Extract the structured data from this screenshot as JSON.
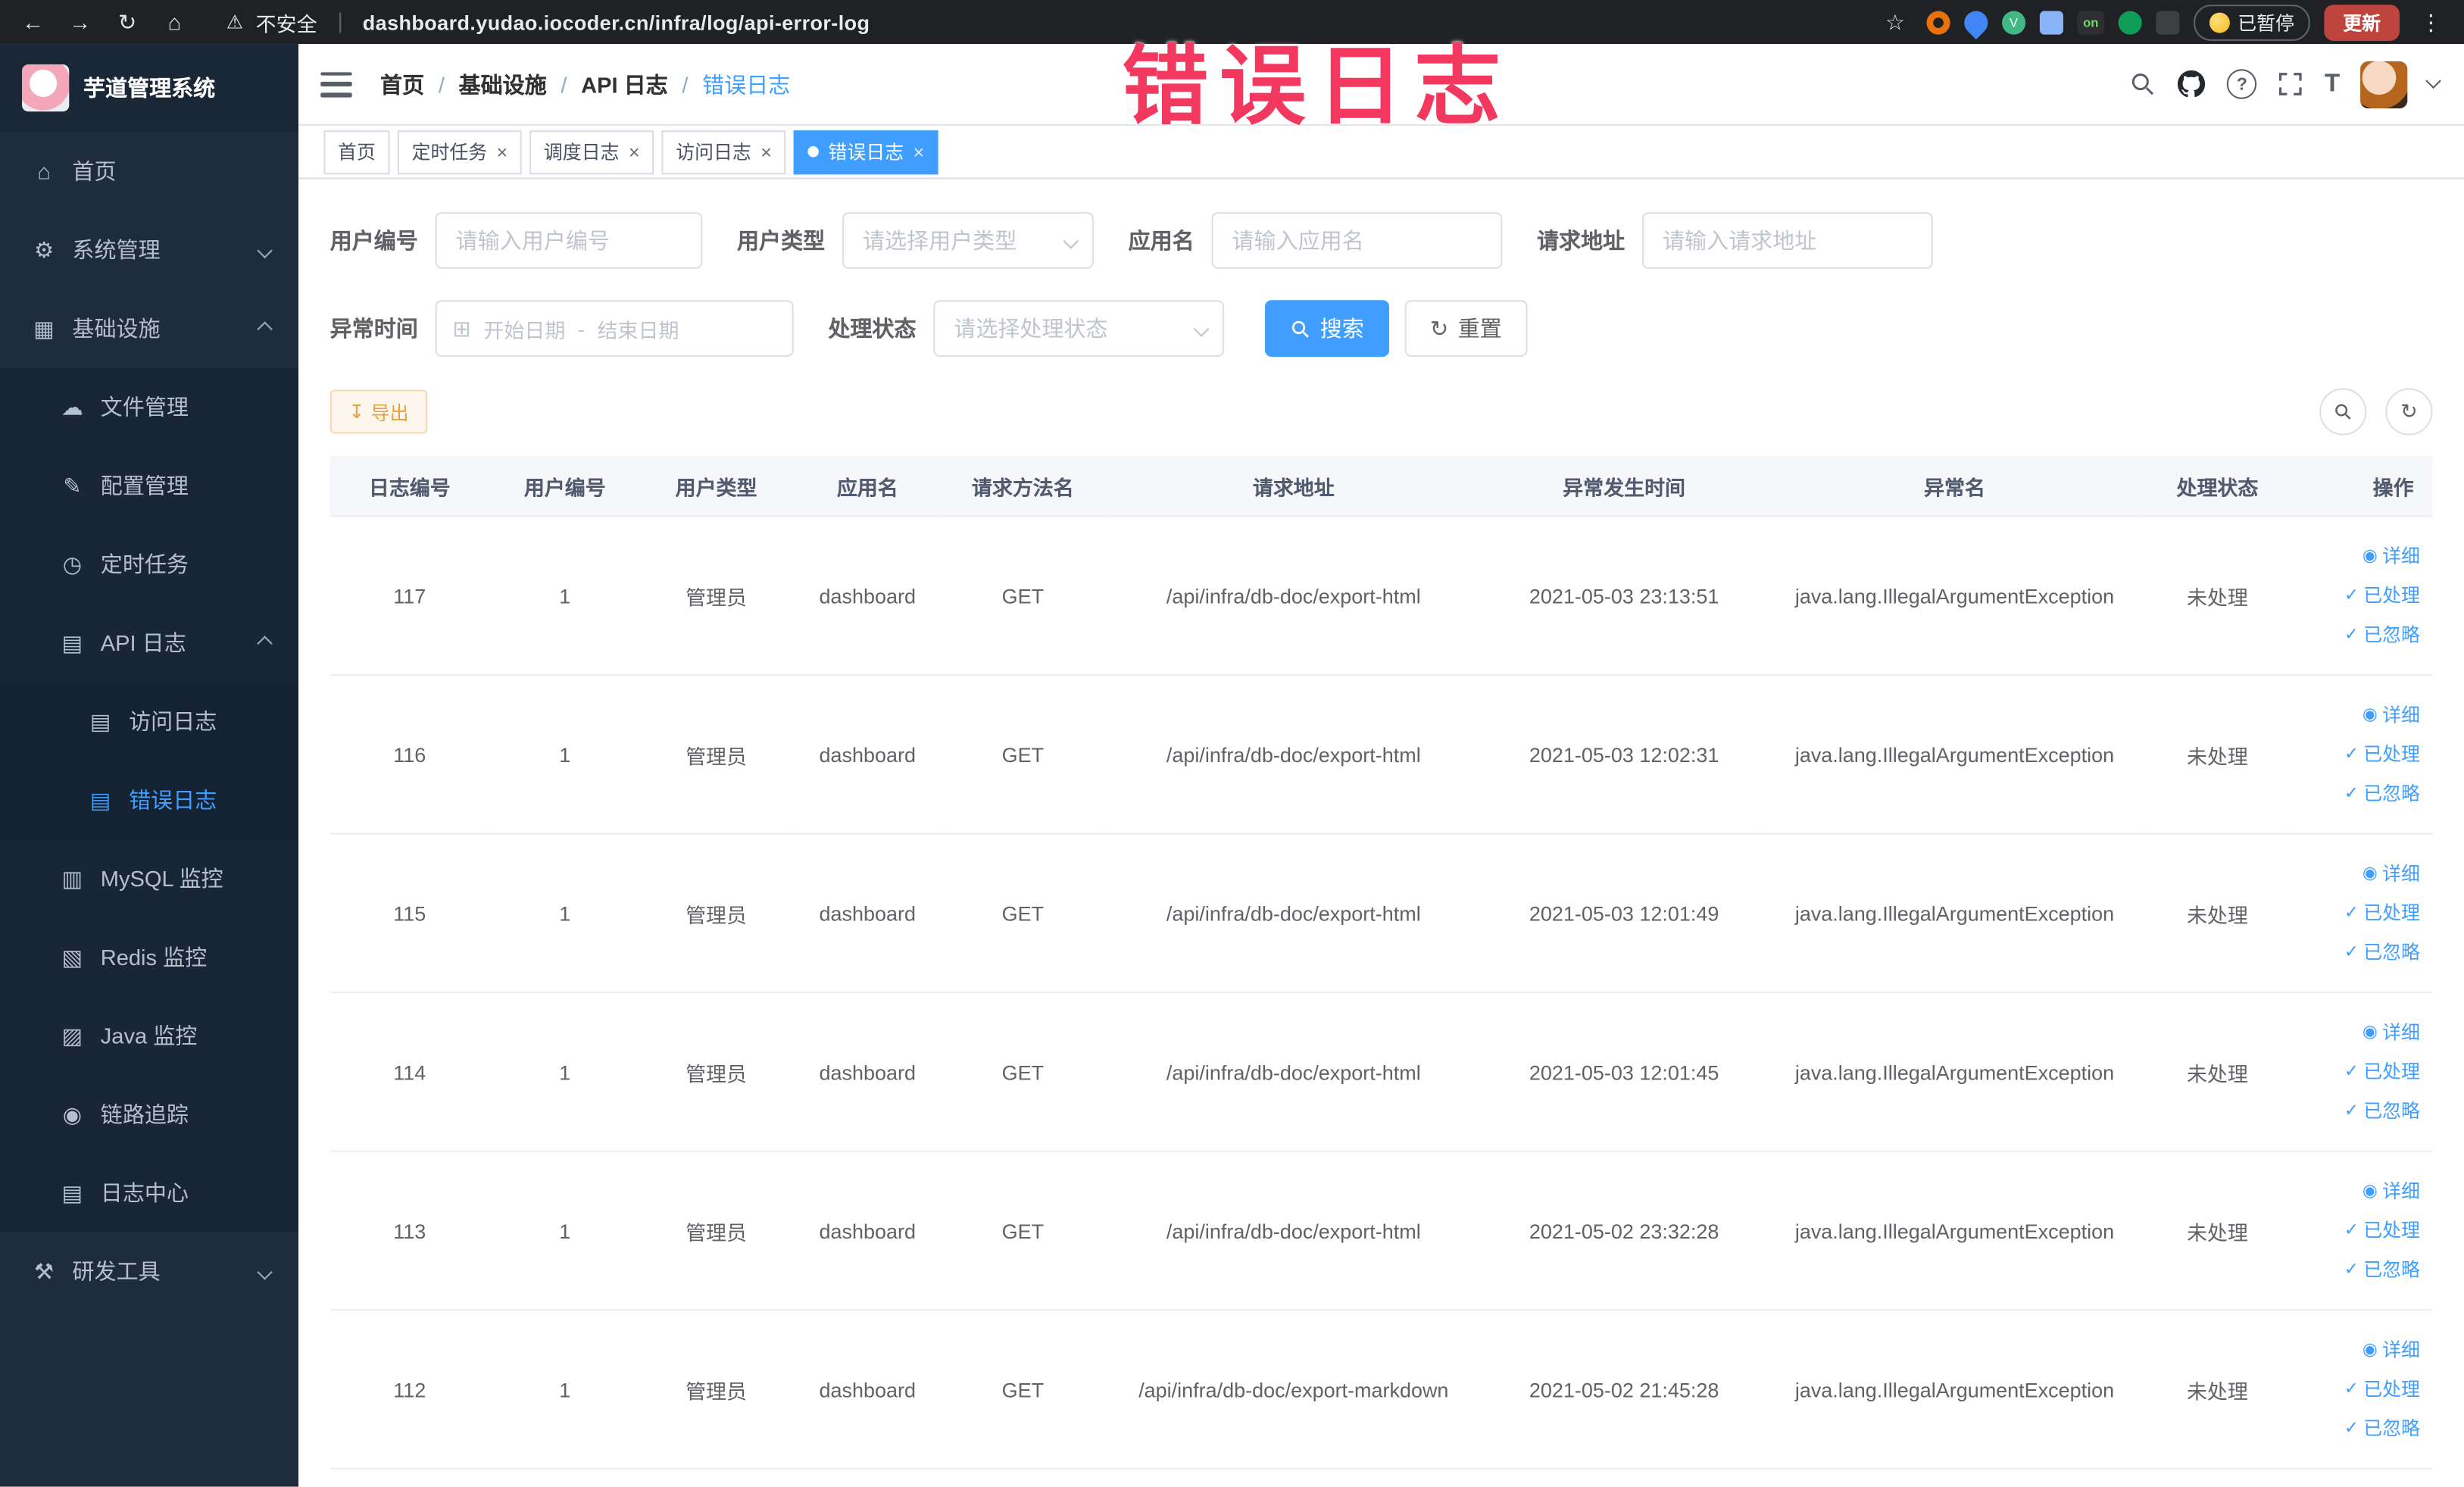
{
  "browser": {
    "security_label": "不安全",
    "url": "dashboard.yudao.iocoder.cn/infra/log/api-error-log",
    "paused_label": "已暂停",
    "update_label": "更新",
    "ext_on_badge": "on"
  },
  "annotation_text": "错误日志",
  "sidebar": {
    "logo_title": "芋道管理系统",
    "menu": [
      {
        "key": "home",
        "label": "首页",
        "icon": "home-icon",
        "level": 0
      },
      {
        "key": "system-mgmt",
        "label": "系统管理",
        "icon": "gear-icon",
        "level": 0,
        "chevron": "down"
      },
      {
        "key": "infrastructure",
        "label": "基础设施",
        "icon": "infra-icon",
        "level": 0,
        "chevron": "up"
      },
      {
        "key": "file-mgmt",
        "label": "文件管理",
        "icon": "file-icon",
        "level": 1
      },
      {
        "key": "config-mgmt",
        "label": "配置管理",
        "icon": "config-icon",
        "level": 1
      },
      {
        "key": "scheduled-tasks",
        "label": "定时任务",
        "icon": "timer-icon",
        "level": 1
      },
      {
        "key": "api-log",
        "label": "API 日志",
        "icon": "api-log-icon",
        "level": 1,
        "chevron": "up"
      },
      {
        "key": "access-log",
        "label": "访问日志",
        "icon": "doc-icon",
        "level": 2
      },
      {
        "key": "error-log",
        "label": "错误日志",
        "icon": "doc-icon",
        "level": 2,
        "active": true
      },
      {
        "key": "mysql-monitor",
        "label": "MySQL 监控",
        "icon": "mysql-icon",
        "level": 1
      },
      {
        "key": "redis-monitor",
        "label": "Redis 监控",
        "icon": "redis-icon",
        "level": 1
      },
      {
        "key": "java-monitor",
        "label": "Java 监控",
        "icon": "java-icon",
        "level": 1
      },
      {
        "key": "link-trace",
        "label": "链路追踪",
        "icon": "trace-icon",
        "level": 1
      },
      {
        "key": "log-center",
        "label": "日志中心",
        "icon": "log-center-icon",
        "level": 1
      },
      {
        "key": "dev-tools",
        "label": "研发工具",
        "icon": "tools-icon",
        "level": 0,
        "chevron": "down"
      }
    ]
  },
  "breadcrumb": {
    "separator": "/",
    "items": [
      "首页",
      "基础设施",
      "API 日志",
      "错误日志"
    ]
  },
  "tabs": [
    {
      "key": "home",
      "label": "首页",
      "closable": false,
      "active": false
    },
    {
      "key": "scheduled-tasks",
      "label": "定时任务",
      "closable": true,
      "active": false
    },
    {
      "key": "job-log",
      "label": "调度日志",
      "closable": true,
      "active": false
    },
    {
      "key": "access-log",
      "label": "访问日志",
      "closable": true,
      "active": false
    },
    {
      "key": "error-log",
      "label": "错误日志",
      "closable": true,
      "active": true
    }
  ],
  "filters": {
    "user_id": {
      "label": "用户编号",
      "placeholder": "请输入用户编号",
      "value": ""
    },
    "user_type": {
      "label": "用户类型",
      "placeholder": "请选择用户类型",
      "value": ""
    },
    "app_name": {
      "label": "应用名",
      "placeholder": "请输入应用名",
      "value": ""
    },
    "request_url": {
      "label": "请求地址",
      "placeholder": "请输入请求地址",
      "value": ""
    },
    "exception_time": {
      "label": "异常时间",
      "start_placeholder": "开始日期",
      "separator": "-",
      "end_placeholder": "结束日期"
    },
    "process_status": {
      "label": "处理状态",
      "placeholder": "请选择处理状态",
      "value": ""
    },
    "search_label": "搜索",
    "reset_label": "重置"
  },
  "toolbar": {
    "export_label": "导出"
  },
  "table": {
    "columns": [
      "日志编号",
      "用户编号",
      "用户类型",
      "应用名",
      "请求方法名",
      "请求地址",
      "异常发生时间",
      "异常名",
      "处理状态",
      "操作"
    ],
    "actions": [
      "详细",
      "已处理",
      "已忽略"
    ],
    "rows": [
      {
        "log_id": "117",
        "user_id": "1",
        "user_type": "管理员",
        "app_name": "dashboard",
        "method": "GET",
        "url": "/api/infra/db-doc/export-html",
        "time": "2021-05-03 23:13:51",
        "exception": "java.lang.IllegalArgumentException",
        "status": "未处理"
      },
      {
        "log_id": "116",
        "user_id": "1",
        "user_type": "管理员",
        "app_name": "dashboard",
        "method": "GET",
        "url": "/api/infra/db-doc/export-html",
        "time": "2021-05-03 12:02:31",
        "exception": "java.lang.IllegalArgumentException",
        "status": "未处理"
      },
      {
        "log_id": "115",
        "user_id": "1",
        "user_type": "管理员",
        "app_name": "dashboard",
        "method": "GET",
        "url": "/api/infra/db-doc/export-html",
        "time": "2021-05-03 12:01:49",
        "exception": "java.lang.IllegalArgumentException",
        "status": "未处理"
      },
      {
        "log_id": "114",
        "user_id": "1",
        "user_type": "管理员",
        "app_name": "dashboard",
        "method": "GET",
        "url": "/api/infra/db-doc/export-html",
        "time": "2021-05-03 12:01:45",
        "exception": "java.lang.IllegalArgumentException",
        "status": "未处理"
      },
      {
        "log_id": "113",
        "user_id": "1",
        "user_type": "管理员",
        "app_name": "dashboard",
        "method": "GET",
        "url": "/api/infra/db-doc/export-html",
        "time": "2021-05-02 23:32:28",
        "exception": "java.lang.IllegalArgumentException",
        "status": "未处理"
      },
      {
        "log_id": "112",
        "user_id": "1",
        "user_type": "管理员",
        "app_name": "dashboard",
        "method": "GET",
        "url": "/api/infra/db-doc/export-markdown",
        "time": "2021-05-02 21:45:28",
        "exception": "java.lang.IllegalArgumentException",
        "status": "未处理"
      }
    ]
  }
}
